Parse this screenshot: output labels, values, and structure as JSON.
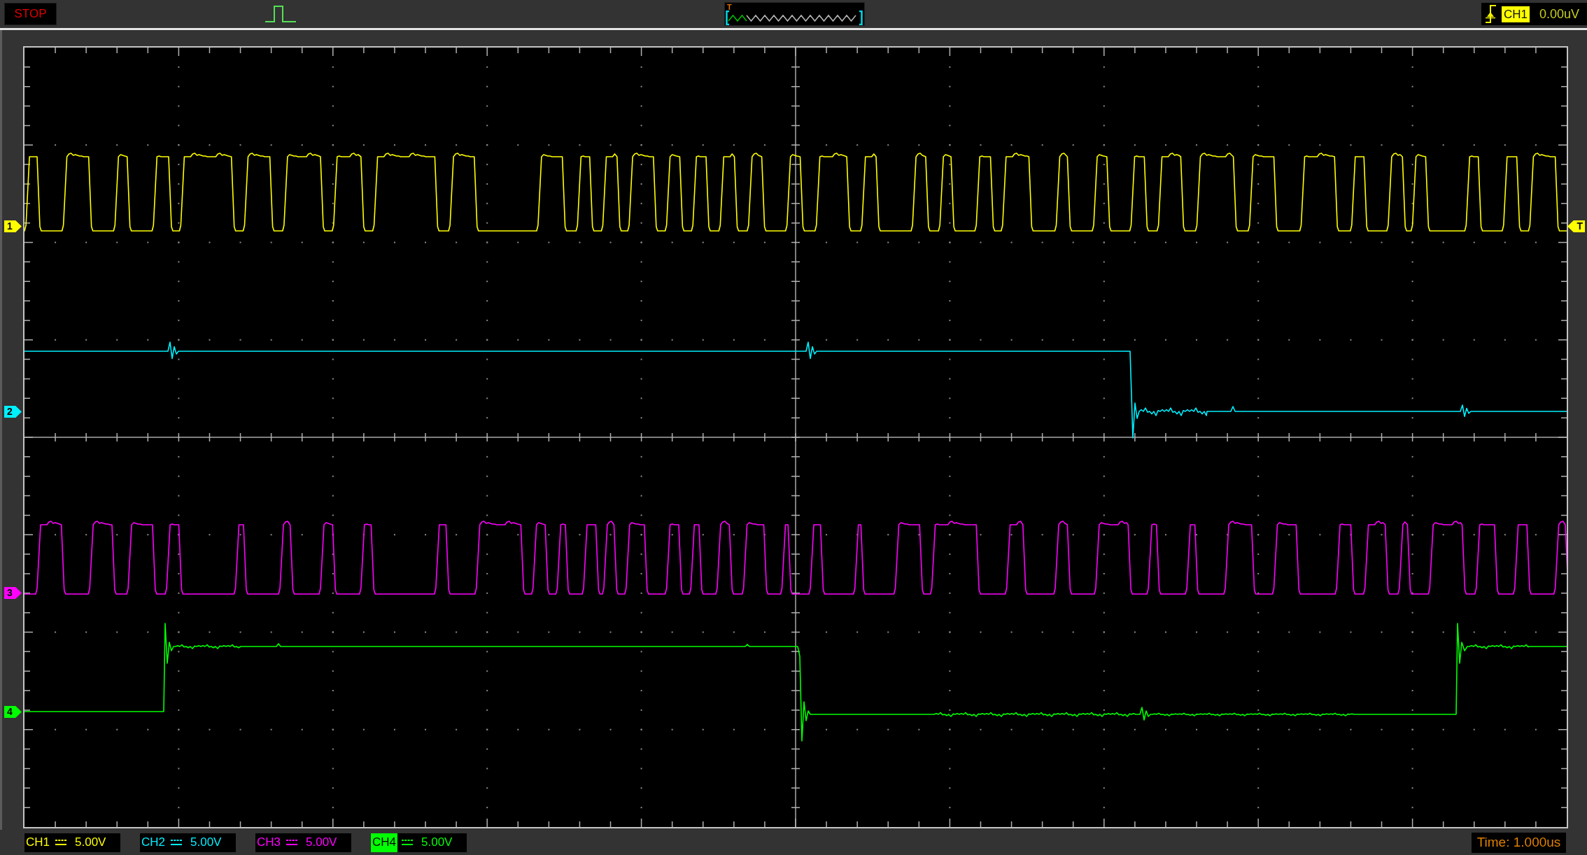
{
  "run_status": "STOP",
  "memory_overview": {
    "trigger_marker": "T"
  },
  "trigger": {
    "rising_edge": true,
    "source": "CH1",
    "level": "0.00uV"
  },
  "trigger_level_marker": "T",
  "channels": [
    {
      "name": "CH1",
      "marker": "1",
      "color": "#ffff00",
      "selected": false,
      "scale": "5.00V"
    },
    {
      "name": "CH2",
      "marker": "2",
      "color": "#00f0ff",
      "selected": false,
      "scale": "5.00V"
    },
    {
      "name": "CH3",
      "marker": "3",
      "color": "#ff00ff",
      "selected": false,
      "scale": "5.00V"
    },
    {
      "name": "CH4",
      "marker": "4",
      "color": "#00ff00",
      "selected": true,
      "scale": "5.00V"
    }
  ],
  "timebase": "Time: 1.000us"
}
